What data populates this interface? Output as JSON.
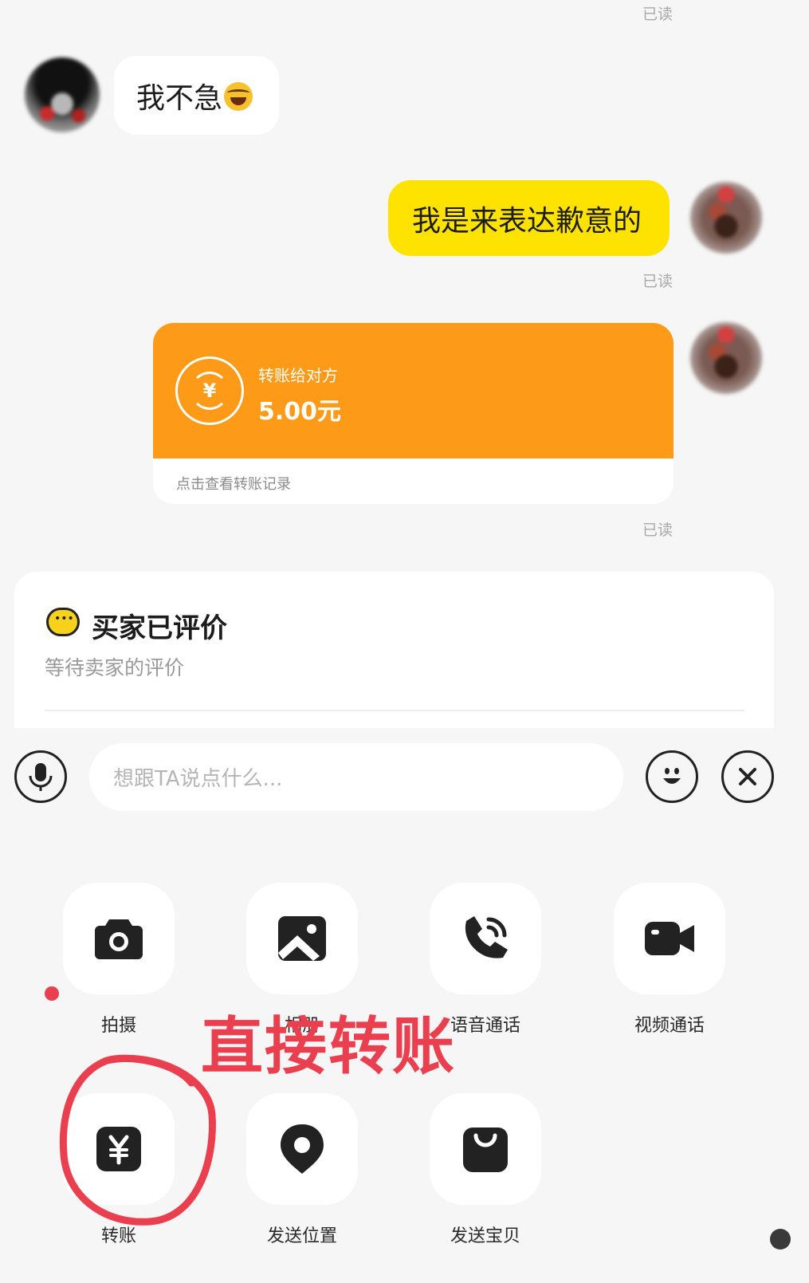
{
  "chat": {
    "read_receipt": "已读",
    "msg_left": "我不急",
    "msg_right": "我是来表达歉意的",
    "transfer": {
      "currency_symbol": "¥",
      "title": "转账给对方",
      "amount": "5.00元",
      "link": "点击查看转账记录"
    }
  },
  "evaluation": {
    "title": "买家已评价",
    "subtitle": "等待卖家的评价"
  },
  "input_bar": {
    "placeholder": "想跟TA说点什么..."
  },
  "actions": [
    {
      "label": "拍摄",
      "icon": "camera-icon"
    },
    {
      "label": "相册",
      "icon": "photo-album-icon"
    },
    {
      "label": "语音通话",
      "icon": "phone-call-icon"
    },
    {
      "label": "视频通话",
      "icon": "video-call-icon"
    },
    {
      "label": "转账",
      "icon": "yen-transfer-icon"
    },
    {
      "label": "发送位置",
      "icon": "location-icon"
    },
    {
      "label": "发送宝贝",
      "icon": "shopping-bag-icon"
    }
  ],
  "annotation": {
    "text": "直接转账"
  },
  "colors": {
    "accent_yellow": "#ffe300",
    "transfer_orange": "#fd9a17",
    "annotation_red": "#ea3f4e"
  }
}
